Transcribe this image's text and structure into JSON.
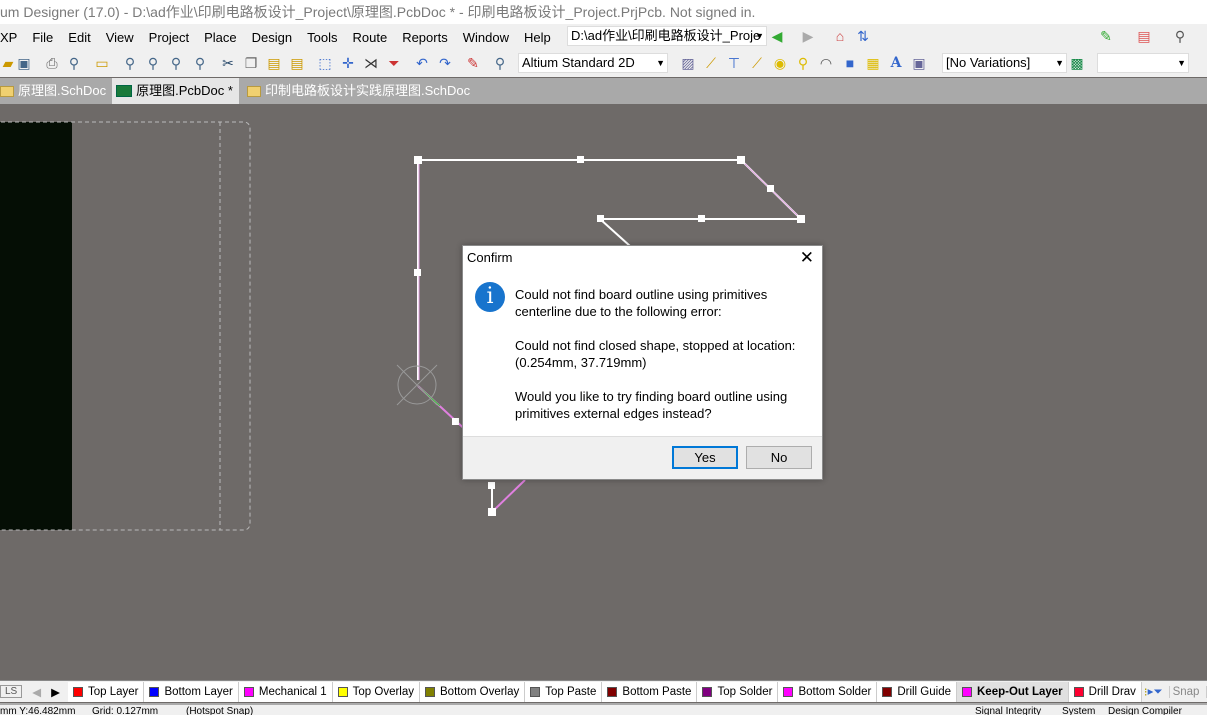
{
  "window": {
    "title": "um Designer (17.0) - D:\\ad作业\\印刷电路板设计_Project\\原理图.PcbDoc * - 印刷电路板设计_Project.PrjPcb. Not signed in."
  },
  "menu": {
    "items": [
      "XP",
      "File",
      "Edit",
      "View",
      "Project",
      "Place",
      "Design",
      "Tools",
      "Route",
      "Reports",
      "Window",
      "Help"
    ],
    "path_combo": "D:\\ad作业\\印刷电路板设计_Proje"
  },
  "toolbar": {
    "view_combo": "Altium Standard 2D",
    "variations_combo": "[No Variations]",
    "extra_combo": ""
  },
  "tabs": [
    {
      "label": "原理图.SchDoc",
      "icon": "schematic-folder-icon"
    },
    {
      "label": "原理图.PcbDoc *",
      "icon": "pcb-icon",
      "active": true
    },
    {
      "label": "印制电路板设计实践原理图.SchDoc",
      "icon": "schematic-folder-icon"
    }
  ],
  "dialog": {
    "title": "Confirm",
    "line1": "Could not find board outline using primitives centerline due to the following error:",
    "line2": "Could not find closed shape, stopped at location: (0.254mm, 37.719mm)",
    "line3": "Would you like to try finding board outline using primitives external edges instead?",
    "yes": "Yes",
    "no": "No"
  },
  "layers": {
    "ls": "LS",
    "items": [
      {
        "name": "Top Layer",
        "color": "#ff0000"
      },
      {
        "name": "Bottom Layer",
        "color": "#0000ff"
      },
      {
        "name": "Mechanical 1",
        "color": "#ff00ff"
      },
      {
        "name": "Top Overlay",
        "color": "#ffff00"
      },
      {
        "name": "Bottom Overlay",
        "color": "#808000"
      },
      {
        "name": "Top Paste",
        "color": "#808080"
      },
      {
        "name": "Bottom Paste",
        "color": "#800000"
      },
      {
        "name": "Top Solder",
        "color": "#800080"
      },
      {
        "name": "Bottom Solder",
        "color": "#ff00ff"
      },
      {
        "name": "Drill Guide",
        "color": "#800000"
      },
      {
        "name": "Keep-Out Layer",
        "color": "#ff00ff",
        "active": true
      },
      {
        "name": "Drill Drav",
        "color": "#ff0030"
      }
    ],
    "snap": "Snap",
    "mask": "M"
  },
  "status": {
    "coords": "mm Y:46.482mm",
    "grid": "Grid: 0.127mm",
    "snap": "(Hotspot Snap)",
    "right": [
      "Signal Integrity",
      "System",
      "Design Compiler"
    ]
  }
}
